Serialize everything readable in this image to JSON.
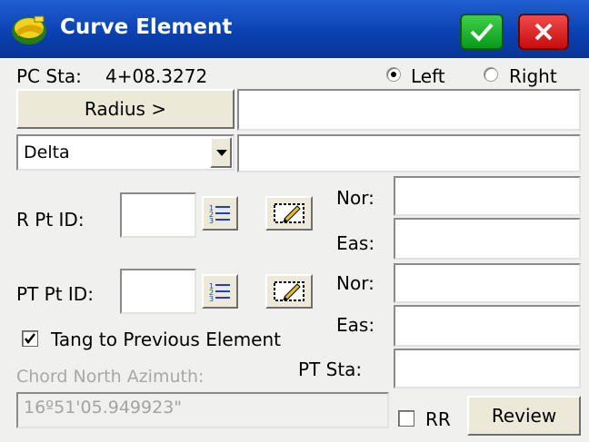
{
  "window": {
    "title": "Curve Element"
  },
  "pc_sta": {
    "label": "PC Sta:",
    "value": "4+08.3272"
  },
  "direction": {
    "left_label": "Left",
    "right_label": "Right",
    "selected": "Left"
  },
  "radius_button_label": "Radius >",
  "radius_value": "",
  "curve_param": {
    "selected": "Delta",
    "value": ""
  },
  "r_point": {
    "label": "R Pt ID:",
    "id": "",
    "nor_label": "Nor:",
    "eas_label": "Eas:",
    "nor": "",
    "eas": ""
  },
  "pt_point": {
    "label": "PT Pt ID:",
    "id": "",
    "nor_label": "Nor:",
    "eas_label": "Eas:",
    "nor": "",
    "eas": ""
  },
  "tangent": {
    "label": "Tang to Previous Element",
    "checked": true
  },
  "pt_sta": {
    "label": "PT Sta:",
    "value": ""
  },
  "chord": {
    "label": "Chord North Azimuth:",
    "value": "16º51'05.949923\""
  },
  "rr": {
    "label": "RR",
    "checked": false
  },
  "review_button_label": "Review",
  "icons": [
    "survey-logo-icon",
    "checkmark-icon",
    "close-icon",
    "list-icon",
    "map-pick-icon",
    "dropdown-arrow-icon"
  ],
  "colors": {
    "titlebar": "#0a3fb0",
    "ok": "#18a82a",
    "cancel": "#d61414"
  }
}
